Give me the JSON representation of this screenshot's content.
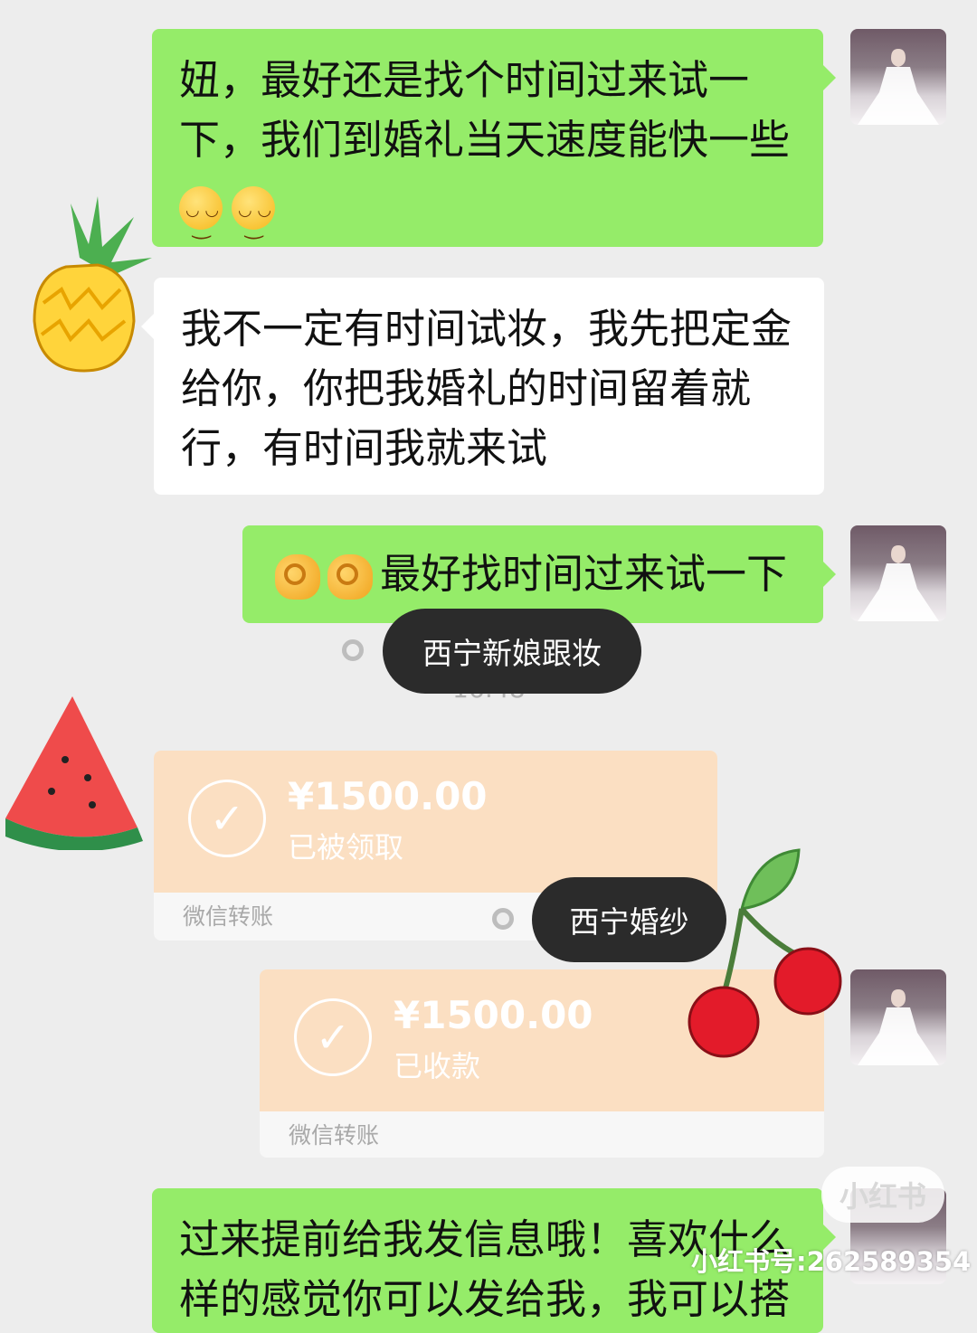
{
  "messages": [
    {
      "id": "m1",
      "side": "right",
      "type": "text",
      "lines": [
        "妞，最好还是找个时间过来试一",
        "下，我们到婚礼当天速度能快一些"
      ],
      "emojis": [
        "smile-blush",
        "smile-blush"
      ]
    },
    {
      "id": "m2",
      "side": "left",
      "type": "text",
      "lines": [
        "我不一定有时间试妆，我先把定金",
        "给你，你把我婚礼的时间留着就",
        "行，有时间我就来试"
      ]
    },
    {
      "id": "m3",
      "side": "right",
      "type": "text",
      "prefix_emojis": [
        "ok-hand",
        "ok-hand"
      ],
      "text": "最好找时间过来试一下"
    },
    {
      "id": "m4",
      "side": "left",
      "type": "transfer",
      "amount": "¥1500.00",
      "status": "已被领取",
      "footer": "微信转账"
    },
    {
      "id": "m5",
      "side": "right",
      "type": "transfer",
      "amount": "¥1500.00",
      "status": "已收款",
      "footer": "微信转账"
    },
    {
      "id": "m6",
      "side": "right",
      "type": "text",
      "lines": [
        "过来提前给我发信息哦！喜欢什么",
        "样的感觉你可以发给我，我可以搭"
      ]
    }
  ],
  "timestamp": "16:48",
  "overlay_tags": [
    {
      "label": "西宁新娘跟妆"
    },
    {
      "label": "西宁婚纱"
    }
  ],
  "stickers": [
    "pineapple",
    "watermelon",
    "cherry"
  ],
  "watermark": {
    "logo": "小红书",
    "id": "小红书号:262589354"
  },
  "colors": {
    "background": "#ededed",
    "my_bubble": "#95ec69",
    "their_bubble": "#ffffff",
    "transfer": "#fbdfc2",
    "tag": "#2b2b2b"
  }
}
